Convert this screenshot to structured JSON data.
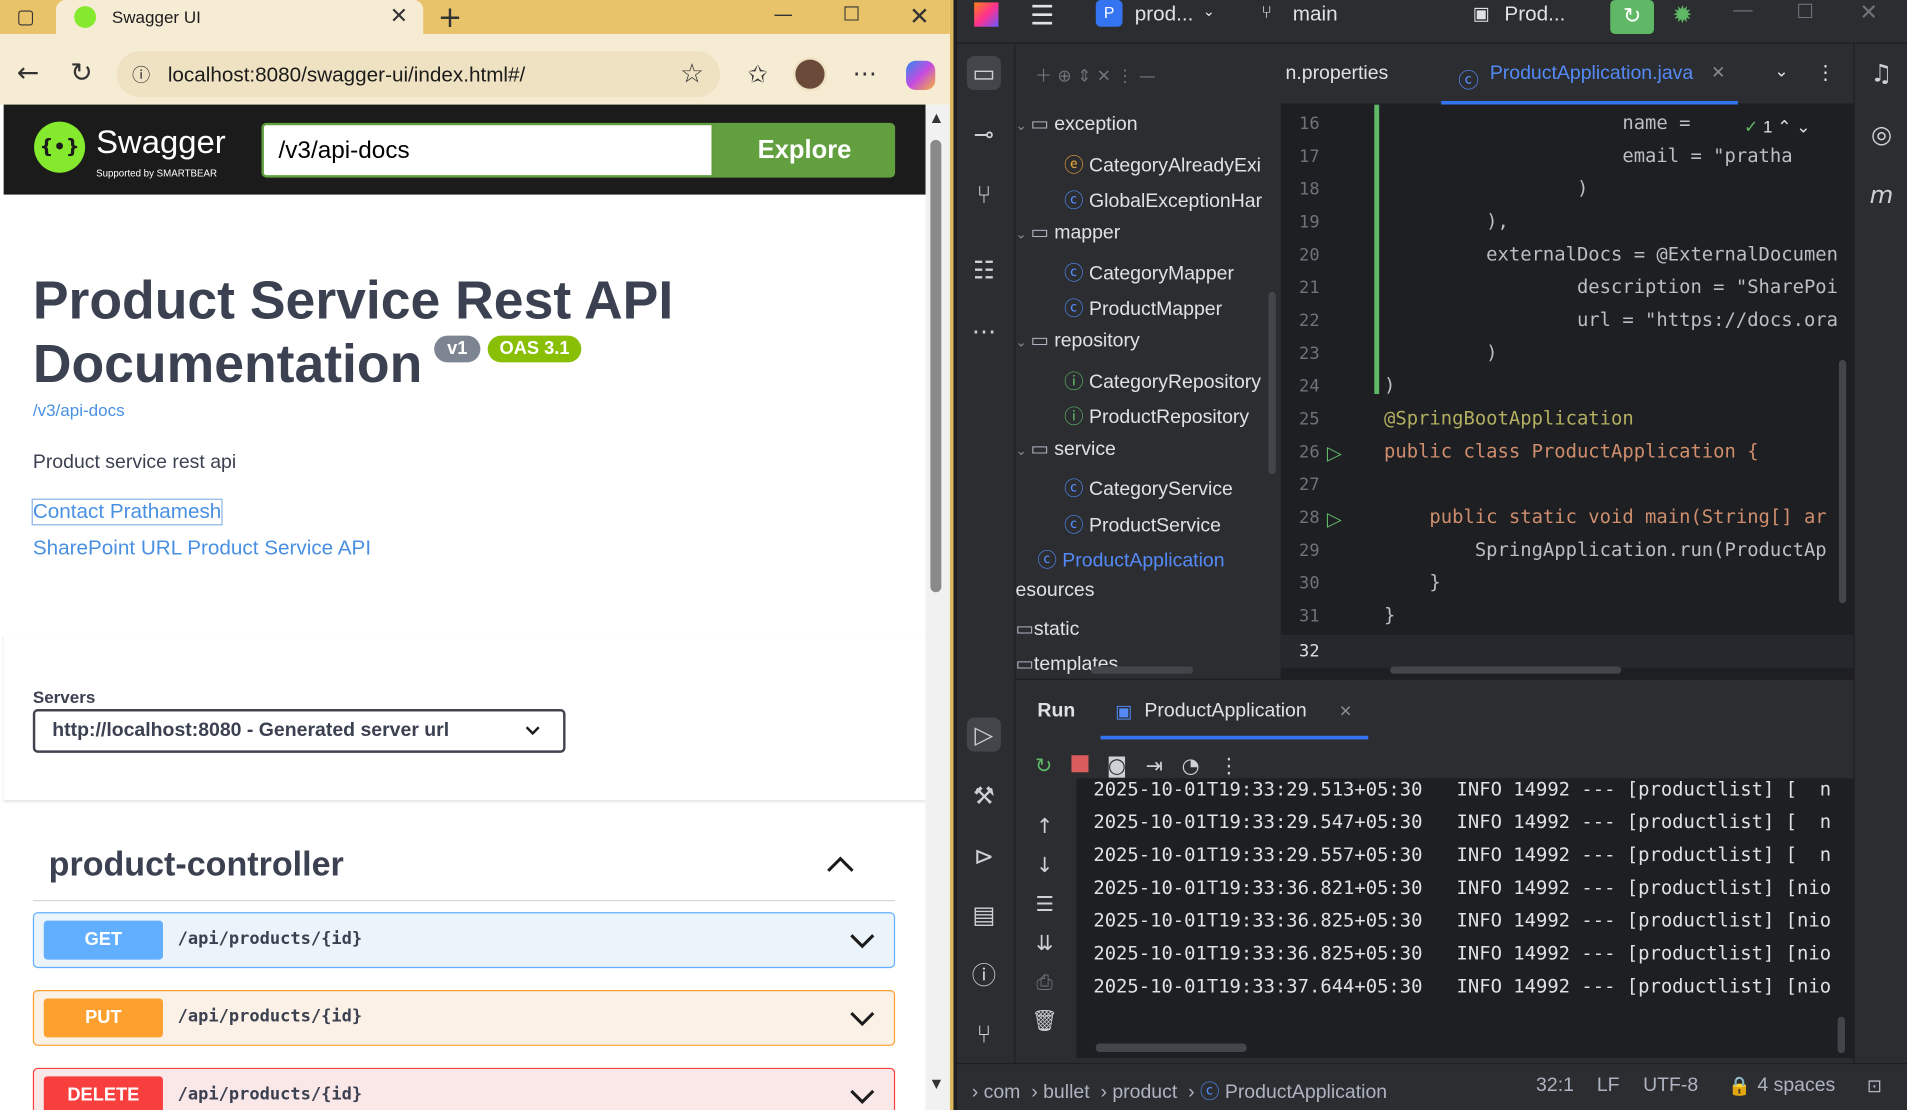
{
  "browser": {
    "tab_title": "Swagger UI",
    "url": "localhost:8080/swagger-ui/index.html#/"
  },
  "swagger": {
    "logo_text": "Swagger",
    "logo_sub": "Supported by SMARTBEAR",
    "api_url": "/v3/api-docs",
    "explore_label": "Explore",
    "title_line1": "Product Service Rest API",
    "title_line2": "Documentation",
    "version_badge": "v1",
    "oas_badge": "OAS 3.1",
    "api_docs_link": "/v3/api-docs",
    "description": "Product service rest api",
    "contact_link": "Contact Prathamesh",
    "external_docs_link": "SharePoint URL Product Service API",
    "servers_label": "Servers",
    "server_selected": "http://localhost:8080 - Generated server url",
    "controller_name": "product-controller",
    "operations": [
      {
        "method": "GET",
        "path": "/api/products/{id}",
        "color": "#61affe",
        "bg": "#ebf3fb"
      },
      {
        "method": "PUT",
        "path": "/api/products/{id}",
        "color": "#fca130",
        "bg": "#fbf1e6"
      },
      {
        "method": "DELETE",
        "path": "/api/products/{id}",
        "color": "#f93e3e",
        "bg": "#fae7e7"
      }
    ]
  },
  "ide": {
    "project": "prod...",
    "branch": "main",
    "run_config": "Prod...",
    "tabs": [
      {
        "label": "n.properties"
      },
      {
        "label": "ProductApplication.java"
      }
    ],
    "tree": [
      {
        "label": "exception",
        "type": "folder"
      },
      {
        "label": "CategoryAlreadyExi",
        "type": "exception"
      },
      {
        "label": "GlobalExceptionHar",
        "type": "class"
      },
      {
        "label": "mapper",
        "type": "folder"
      },
      {
        "label": "CategoryMapper",
        "type": "class"
      },
      {
        "label": "ProductMapper",
        "type": "class"
      },
      {
        "label": "repository",
        "type": "folder"
      },
      {
        "label": "CategoryRepository",
        "type": "interface"
      },
      {
        "label": "ProductRepository",
        "type": "interface"
      },
      {
        "label": "service",
        "type": "folder"
      },
      {
        "label": "CategoryService",
        "type": "class"
      },
      {
        "label": "ProductService",
        "type": "class"
      },
      {
        "label": "ProductApplication",
        "type": "app"
      },
      {
        "label": "esources",
        "type": "plain"
      },
      {
        "label": "static",
        "type": "folder"
      },
      {
        "label": "templates",
        "type": "folder"
      }
    ],
    "line_numbers": [
      "16",
      "17",
      "18",
      "19",
      "20",
      "21",
      "22",
      "23",
      "24",
      "25",
      "26",
      "27",
      "28",
      "29",
      "30",
      "31",
      "32"
    ],
    "code": [
      "                     name = ",
      "                     email = \"pratha",
      "                 )",
      "         ),",
      "         externalDocs = @ExternalDocumen",
      "                 description = \"SharePoi",
      "                 url = \"https://docs.ora",
      "         )",
      ")",
      "@SpringBootApplication",
      "public class ProductApplication {",
      "",
      "    public static void main(String[] ar",
      "        SpringApplication.run(ProductAp",
      "    }",
      "}",
      ""
    ],
    "inspection_count": "1",
    "run_tab": "Run",
    "run_config_tab": "ProductApplication",
    "logs": [
      "2025-10-01T19:33:29.513+05:30   INFO 14992 --- [productlist] [  n",
      "2025-10-01T19:33:29.547+05:30   INFO 14992 --- [productlist] [  n",
      "2025-10-01T19:33:29.557+05:30   INFO 14992 --- [productlist] [  n",
      "2025-10-01T19:33:36.821+05:30   INFO 14992 --- [productlist] [nio",
      "2025-10-01T19:33:36.825+05:30   INFO 14992 --- [productlist] [nio",
      "2025-10-01T19:33:36.825+05:30   INFO 14992 --- [productlist] [nio",
      "2025-10-01T19:33:37.644+05:30   INFO 14992 --- [productlist] [nio"
    ],
    "status": {
      "crumbs": [
        "com",
        "bullet",
        "product",
        "ProductApplication"
      ],
      "position": "32:1",
      "line_sep": "LF",
      "encoding": "UTF-8",
      "indent": "4 spaces"
    }
  }
}
